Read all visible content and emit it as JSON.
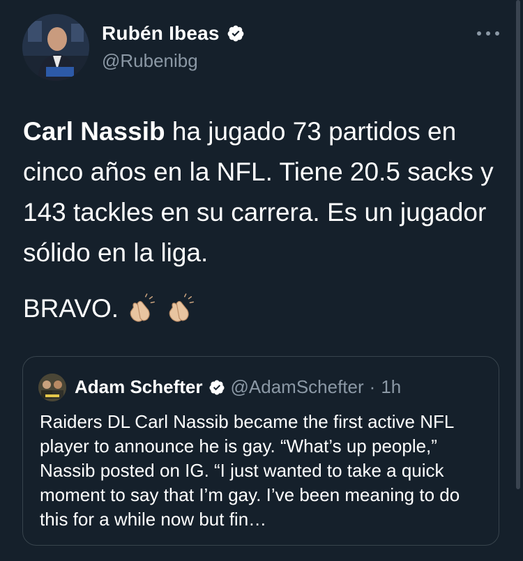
{
  "author": {
    "display_name": "Rubén Ibeas",
    "handle": "@Rubenibg",
    "verified_icon": "verified-badge-icon",
    "more_icon": "more-options-icon"
  },
  "tweet": {
    "mention_bold": "Carl Nassib",
    "text_rest": " ha jugado 73 partidos en cinco años en la NFL. Tiene 20.5 sacks y 143 tackles en su carrera. Es un jugador sólido en la liga.",
    "bravo": "BRAVO.",
    "emoji": "clapping-hands-icon"
  },
  "quoted_tweet": {
    "display_name": "Adam Schefter",
    "handle": "@AdamSchefter",
    "separator": "·",
    "time": "1h",
    "text": "Raiders DL Carl Nassib became the first active NFL player to announce he is gay. “What’s up people,” Nassib posted on IG. “I just wanted to take a quick moment to say that I’m gay. I’ve been meaning to do this for a while now but fin…"
  },
  "colors": {
    "background": "#15202b",
    "secondary_text": "#8b98a5",
    "border": "#38444d",
    "verified_blue": "#ffffff"
  }
}
